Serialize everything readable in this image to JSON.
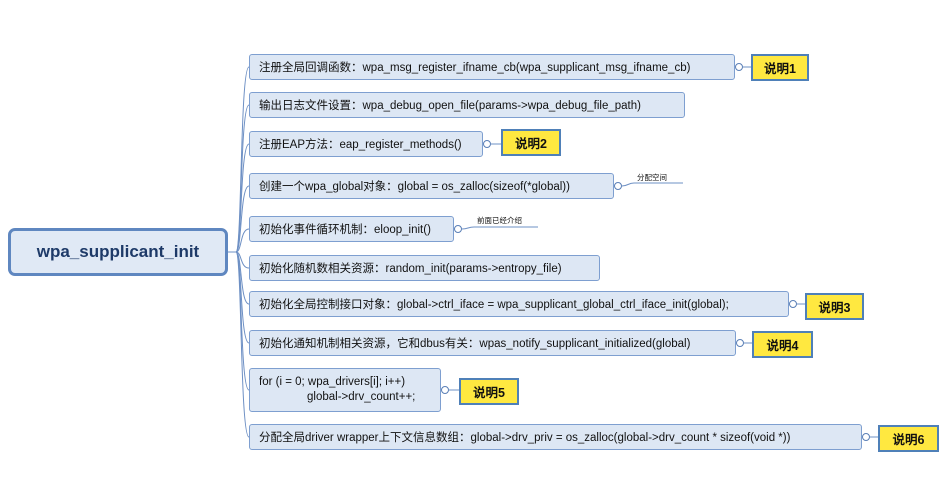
{
  "root": {
    "label": "wpa_supplicant_init"
  },
  "steps": [
    {
      "text": "注册全局回调函数：wpa_msg_register_ifname_cb(wpa_supplicant_msg_ifname_cb)",
      "badge": "说明1"
    },
    {
      "text": "输出日志文件设置：wpa_debug_open_file(params->wpa_debug_file_path)"
    },
    {
      "text": "注册EAP方法：eap_register_methods()",
      "badge": "说明2"
    },
    {
      "text": "创建一个wpa_global对象：global = os_zalloc(sizeof(*global))",
      "note": "分配空间"
    },
    {
      "text": "初始化事件循环机制：eloop_init()",
      "note": "前面已经介绍"
    },
    {
      "text": "初始化随机数相关资源：random_init(params->entropy_file)"
    },
    {
      "text": "初始化全局控制接口对象：global->ctrl_iface = wpa_supplicant_global_ctrl_iface_init(global);",
      "badge": "说明3"
    },
    {
      "text": "初始化通知机制相关资源，它和dbus有关：wpas_notify_supplicant_initialized(global)",
      "badge": "说明4"
    },
    {
      "lines": [
        "for (i = 0; wpa_drivers[i]; i++)",
        "global->drv_count++;"
      ],
      "badge": "说明5"
    },
    {
      "text": "分配全局driver wrapper上下文信息数组：global->drv_priv = os_zalloc(global->drv_count * sizeof(void *))",
      "badge": "说明6"
    }
  ],
  "colors": {
    "connector": "#6e90c4",
    "node_fill": "#dde7f4",
    "badge_fill": "#ffe840"
  }
}
